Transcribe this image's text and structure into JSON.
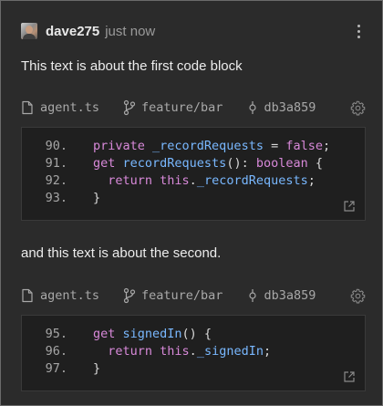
{
  "header": {
    "username": "dave275",
    "timestamp": "just now",
    "menu_icon": "kebab-menu-icon"
  },
  "paragraphs": [
    "This text is about the first code block",
    "and this text is about the second."
  ],
  "code_blocks": [
    {
      "file": "agent.ts",
      "branch": "feature/bar",
      "commit": "db3a859",
      "lines": [
        {
          "num": "90.",
          "segments": [
            {
              "t": "private ",
              "c": "kw"
            },
            {
              "t": "_recordRequests",
              "c": "fn"
            },
            {
              "t": " = ",
              "c": ""
            },
            {
              "t": "false",
              "c": "kw"
            },
            {
              "t": ";",
              "c": ""
            }
          ]
        },
        {
          "num": "91.",
          "segments": [
            {
              "t": "get ",
              "c": "kw"
            },
            {
              "t": "recordRequests",
              "c": "fn"
            },
            {
              "t": "(): ",
              "c": ""
            },
            {
              "t": "boolean",
              "c": "kw"
            },
            {
              "t": " {",
              "c": ""
            }
          ]
        },
        {
          "num": "92.",
          "segments": [
            {
              "t": "  return ",
              "c": "kw"
            },
            {
              "t": "this",
              "c": "kw"
            },
            {
              "t": ".",
              "c": ""
            },
            {
              "t": "_recordRequests",
              "c": "fn"
            },
            {
              "t": ";",
              "c": ""
            }
          ]
        },
        {
          "num": "93.",
          "segments": [
            {
              "t": "}",
              "c": ""
            }
          ]
        }
      ]
    },
    {
      "file": "agent.ts",
      "branch": "feature/bar",
      "commit": "db3a859",
      "lines": [
        {
          "num": "95.",
          "segments": [
            {
              "t": "get ",
              "c": "kw"
            },
            {
              "t": "signedIn",
              "c": "fn"
            },
            {
              "t": "() {",
              "c": ""
            }
          ]
        },
        {
          "num": "96.",
          "segments": [
            {
              "t": "  return ",
              "c": "kw"
            },
            {
              "t": "this",
              "c": "kw"
            },
            {
              "t": ".",
              "c": ""
            },
            {
              "t": "_signedIn",
              "c": "fn"
            },
            {
              "t": ";",
              "c": ""
            }
          ]
        },
        {
          "num": "97.",
          "segments": [
            {
              "t": "}",
              "c": ""
            }
          ]
        }
      ]
    }
  ],
  "colors": {
    "background": "#2b2b2b",
    "code_background": "#1f1f1f",
    "keyword": "#d889d9",
    "identifier": "#79b8ff",
    "text": "#ececec",
    "muted": "#9a9a9a"
  },
  "icons": {
    "file": "file-icon",
    "branch": "git-branch-icon",
    "commit": "git-commit-icon",
    "settings": "gear-icon",
    "open": "open-external-icon"
  }
}
